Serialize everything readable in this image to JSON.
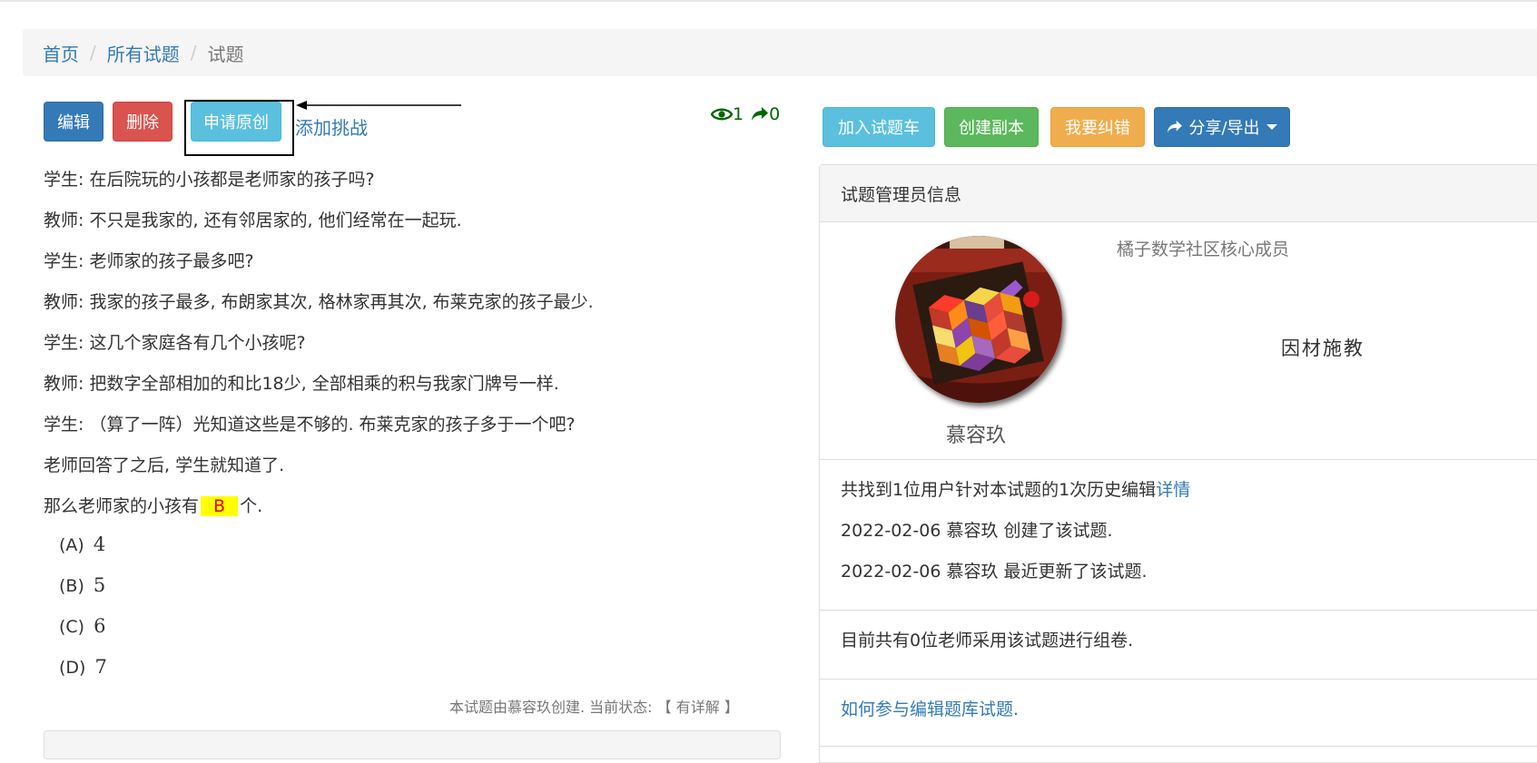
{
  "breadcrumb": {
    "home": "首页",
    "all": "所有试题",
    "current": "试题",
    "separator": "/"
  },
  "toolbar": {
    "edit": "编辑",
    "delete": "删除",
    "apply_original": "申请原创",
    "add_challenge": "添加挑战",
    "views": "1",
    "shares": "0"
  },
  "right_toolbar": {
    "add_cart": "加入试题车",
    "create_copy": "创建副本",
    "report_error": "我要纠错",
    "share_export": "分享/导出"
  },
  "question": {
    "lines": [
      "学生: 在后院玩的小孩都是老师家的孩子吗?",
      "教师: 不只是我家的, 还有邻居家的, 他们经常在一起玩.",
      "学生: 老师家的孩子最多吧?",
      "教师: 我家的孩子最多, 布朗家其次, 格林家再其次, 布莱克家的孩子最少.",
      "学生: 这几个家庭各有几个小孩呢?",
      "教师: 把数字全部相加的和比18少, 全部相乘的积与我家门牌号一样.",
      "学生: （算了一阵）光知道这些是不够的. 布莱克家的孩子多于一个吧?",
      "老师回答了之后, 学生就知道了."
    ],
    "final_prefix": "那么老师家的小孩有",
    "answer": "B",
    "final_suffix": "个.",
    "options": [
      {
        "label": "(A)",
        "value": "4"
      },
      {
        "label": "(B)",
        "value": "5"
      },
      {
        "label": "(C)",
        "value": "6"
      },
      {
        "label": "(D)",
        "value": "7"
      }
    ],
    "creator_note": "本试题由慕容玖创建. 当前状态: 【 有详解 】"
  },
  "admin_panel": {
    "title": "试题管理员信息",
    "member_role": "橘子数学社区核心成员",
    "user_name": "慕容玖",
    "motto": "因材施教",
    "history_text": "共找到1位用户针对本试题的1次历史编辑",
    "history_link": "详情",
    "created": "2022-02-06 慕容玖 创建了该试题.",
    "updated": "2022-02-06 慕容玖 最近更新了该试题.",
    "teachers_text": "目前共有0位老师采用该试题进行组卷.",
    "help_link": "如何参与编辑题库试题."
  },
  "colors": {
    "primary": "#337ab7",
    "danger": "#d9534f",
    "info": "#5bc0de",
    "success": "#5cb85c",
    "warning": "#f0ad4e",
    "answer_bg": "#ffff00",
    "answer_text": "#e00000",
    "stats": "#006600"
  },
  "icons": {
    "views": "eye-icon",
    "shares": "share-arrow-icon",
    "share_export": "share-arrow-icon",
    "dropdown": "caret-down-icon"
  }
}
